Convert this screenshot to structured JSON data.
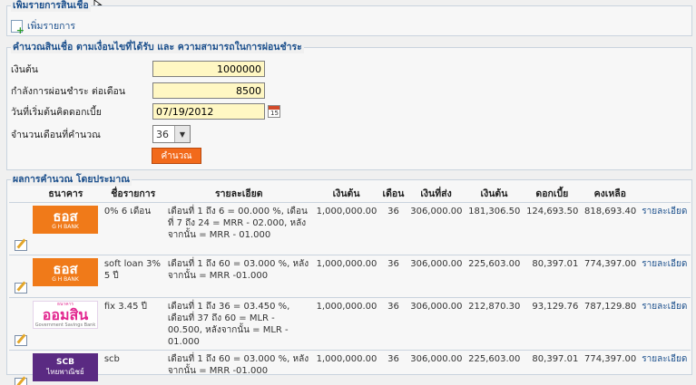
{
  "add_section": {
    "legend": "เพิ่มรายการสินเชื่อ",
    "add_link": "เพิ่มรายการ"
  },
  "calc_section": {
    "legend": "คำนวณสินเชื่อ ตามเงื่อนไขที่ได้รับ และ ความสามารถในการผ่อนชำระ",
    "principal_label": "เงินต้น",
    "principal_value": "1000000",
    "payment_label": "กำลังการผ่อนชำระ ต่อเดือน",
    "payment_value": "8500",
    "start_date_label": "วันที่เริ่มต้นคิดดอกเบี้ย",
    "start_date_value": "07/19/2012",
    "months_label": "จำนวนเดือนที่คำนวณ",
    "months_value": "36",
    "calc_button": "คำนวณ"
  },
  "results": {
    "legend": "ผลการคำนวณ โดยประมาณ",
    "headers": [
      "ธนาคาร",
      "ชื่อรายการ",
      "รายละเอียด",
      "เงินต้น",
      "เดือน",
      "เงินที่ส่ง",
      "เงินต้น",
      "ดอกเบี้ย",
      "คงเหลือ"
    ],
    "detail_link": "รายละเอียด",
    "rows": [
      {
        "bank_logo": "ghb",
        "logo_main": "ธอส",
        "logo_sub": "G H BANK",
        "name": "0% 6 เดือน",
        "details": "เดือนที่ 1 ถึง 6 = 00.000 %, เดือนที่ 7 ถึง 24 = MRR - 02.000, หลังจากนั้น = MRR - 01.000",
        "principal": "1,000,000.00",
        "months": "36",
        "paid": "306,000.00",
        "principal_paid": "181,306.50",
        "interest": "124,693.50",
        "remaining": "818,693.40"
      },
      {
        "bank_logo": "ghb",
        "logo_main": "ธอส",
        "logo_sub": "G H BANK",
        "name": "soft loan 3% 5 ปี",
        "details": "เดือนที่ 1 ถึง 60 = 03.000 %, หลังจากนั้น = MRR -01.000",
        "principal": "1,000,000.00",
        "months": "36",
        "paid": "306,000.00",
        "principal_paid": "225,603.00",
        "interest": "80,397.01",
        "remaining": "774,397.00"
      },
      {
        "bank_logo": "gsb",
        "logo_top": "ธนาคาร",
        "logo_main": "ออมสิน",
        "logo_sub": "Government Savings Bank",
        "name": "fix 3.45 ปี",
        "details": "เดือนที่ 1 ถึง 36 = 03.450 %, เดือนที่ 37 ถึง 60 = MLR - 00.500, หลังจากนั้น = MLR - 01.000",
        "principal": "1,000,000.00",
        "months": "36",
        "paid": "306,000.00",
        "principal_paid": "212,870.30",
        "interest": "93,129.76",
        "remaining": "787,129.80"
      },
      {
        "bank_logo": "scb",
        "logo_main": "SCB",
        "logo_sub": "ไทยพาณิชย์",
        "name": "scb",
        "details": "เดือนที่ 1 ถึง 60 = 03.000 %, หลังจากนั้น = MRR -01.000",
        "principal": "1,000,000.00",
        "months": "36",
        "paid": "306,000.00",
        "principal_paid": "225,603.00",
        "interest": "80,397.01",
        "remaining": "774,397.00"
      }
    ]
  },
  "colors": {
    "accent": "#1b4f8c",
    "button": "#f26a1b",
    "input_bg": "#fff7c3",
    "ghb": "#f07a19",
    "gsb": "#e2268f",
    "scb": "#5a2a82"
  }
}
